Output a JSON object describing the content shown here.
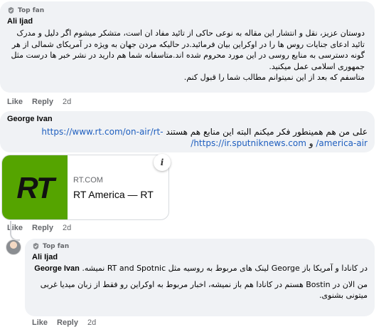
{
  "comments": [
    {
      "badge": "Top fan",
      "author": "Ali Ijad",
      "text": "دوستان عزیز، نقل و انتشار این مقاله به نوعی حاکی از تائید مفاد ان است، متشکر میشوم اگر دلیل و مدرک تائید ادعای جنایات روس ها را در اوکراین بیان فرمائید.در حالیکه مردن جهان به ویژه در آمریکای شمالی از هر گونه دسترسی به منابع روسی در این مورد محروم شده اند.متاسفانه شما هم دارید در نشر خبر ها درست مثل جمهوری اسلامی عمل میکنید.",
      "text2": "متاسفم که بعد از این نمیتوانم مطالب شما را قبول کنم.",
      "actions": {
        "like": "Like",
        "reply": "Reply",
        "time": "2d"
      }
    },
    {
      "author": "George Ivan",
      "text_prefix": "علی من هم همینطور فکر میکنم البته این منابع هم هستند",
      "link1": "https://www.rt.com/on-air/rt-america-air/",
      "conj": "و",
      "link2": "https://ir.sputniknews.com/",
      "preview": {
        "logo": "RT",
        "domain": "RT.COM",
        "title": "RT America — RT",
        "info": "i"
      },
      "actions": {
        "like": "Like",
        "reply": "Reply",
        "time": "2d"
      }
    },
    {
      "badge": "Top fan",
      "author": "Ali Ijad",
      "mention": "George Ivan",
      "text_line1": "در کانادا و آمریکا باز George لینک های مربوط به روسیه مثل RT and Spotnic نمیشه.",
      "text_line2": "من الان در Bostin هستم در کانادا هم باز نمیشه، اخبار مربوط به اوکراین رو فقط از زبان میدیا غربی میتونی بشنوی.",
      "actions": {
        "like": "Like",
        "reply": "Reply",
        "time": "2d"
      }
    }
  ],
  "colors": {
    "bubble": "#f0f2f5",
    "link": "#1f5fbf",
    "muted": "#65676b",
    "rt_green": "#55a400"
  },
  "icons": {
    "top_fan": "top-fan-badge-icon",
    "info": "info-icon",
    "avatar": "user-avatar"
  }
}
